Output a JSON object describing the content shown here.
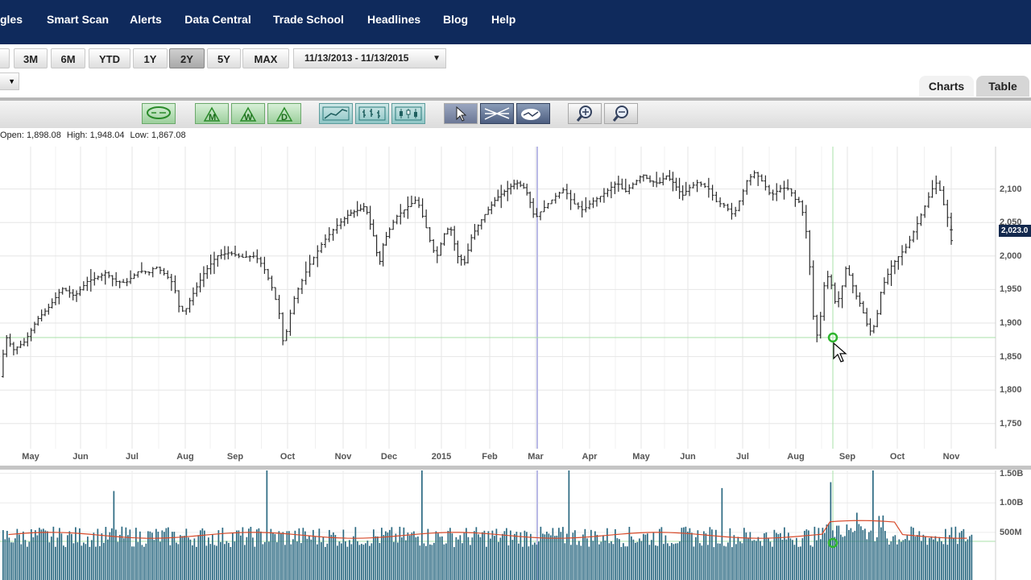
{
  "nav": {
    "items": [
      "gles",
      "Smart Scan",
      "Alerts",
      "Data Central",
      "Trade School",
      "Headlines",
      "Blog",
      "Help"
    ]
  },
  "range": {
    "buttons": [
      "3M",
      "6M",
      "YTD",
      "1Y",
      "2Y",
      "5Y",
      "MAX"
    ],
    "selected": "2Y",
    "date_range": "11/13/2013 - 11/13/2015"
  },
  "view_tabs": [
    "Charts",
    "Table"
  ],
  "toolbar": {
    "icons": [
      "comment-icon",
      "monthly-m-icon",
      "weekly-w-icon",
      "daily-d-icon",
      "line-chart-icon",
      "ohlc-bar-icon",
      "candlestick-icon",
      "pointer-icon",
      "draw-lines-icon",
      "overlay-icon",
      "zoom-in-icon",
      "zoom-out-icon"
    ]
  },
  "ohlc": {
    "open": "Open: 1,898.08",
    "high": "High: 1,948.04",
    "low": "Low: 1,867.08"
  },
  "chart_data": {
    "type": "ohlc-bar",
    "x_tick_labels": [
      "May",
      "Jun",
      "Jul",
      "Aug",
      "Sep",
      "Oct",
      "Nov",
      "Dec",
      "2015",
      "Feb",
      "Mar",
      "Apr",
      "May",
      "Jun",
      "Jul",
      "Aug",
      "Sep",
      "Oct",
      "Nov"
    ],
    "y_tick_labels": [
      "2,100",
      "2,050",
      "2,000",
      "1,950",
      "1,900",
      "1,850",
      "1,800",
      "1,750"
    ],
    "ylim": [
      1725,
      2150
    ],
    "current_price_label": "2,023.0",
    "price_series": [
      [
        0,
        1820
      ],
      [
        0.25,
        1880
      ],
      [
        0.55,
        1860
      ],
      [
        1,
        1872
      ],
      [
        1.5,
        1905
      ],
      [
        2,
        1925
      ],
      [
        2.5,
        1952
      ],
      [
        3,
        1940
      ],
      [
        3.5,
        1962
      ],
      [
        4,
        1970
      ],
      [
        4.2,
        1975
      ],
      [
        4.6,
        1962
      ],
      [
        5,
        1960
      ],
      [
        5.5,
        1978
      ],
      [
        5.9,
        1975
      ],
      [
        6.1,
        1985
      ],
      [
        6.5,
        1972
      ],
      [
        6.8,
        1958
      ],
      [
        7,
        1925
      ],
      [
        7.2,
        1915
      ],
      [
        7.5,
        1940
      ],
      [
        8,
        1975
      ],
      [
        8.5,
        2000
      ],
      [
        9,
        2005
      ],
      [
        9.5,
        1998
      ],
      [
        10,
        2000
      ],
      [
        10.3,
        1985
      ],
      [
        10.6,
        1958
      ],
      [
        10.9,
        1920
      ],
      [
        11.1,
        1862
      ],
      [
        11.25,
        1900
      ],
      [
        11.5,
        1940
      ],
      [
        12,
        1985
      ],
      [
        12.5,
        2020
      ],
      [
        13,
        2045
      ],
      [
        13.5,
        2063
      ],
      [
        14,
        2070
      ],
      [
        14.2,
        2075
      ],
      [
        14.4,
        2050
      ],
      [
        14.6,
        2025
      ],
      [
        14.8,
        1985
      ],
      [
        15,
        2020
      ],
      [
        15.5,
        2058
      ],
      [
        16,
        2075
      ],
      [
        16.3,
        2085
      ],
      [
        16.6,
        2050
      ],
      [
        16.9,
        2010
      ],
      [
        17.1,
        2000
      ],
      [
        17.3,
        2030
      ],
      [
        17.6,
        2045
      ],
      [
        17.9,
        2000
      ],
      [
        18.2,
        1990
      ],
      [
        18.5,
        2030
      ],
      [
        19,
        2060
      ],
      [
        19.5,
        2085
      ],
      [
        20,
        2100
      ],
      [
        20.4,
        2110
      ],
      [
        20.8,
        2100
      ],
      [
        21,
        2080
      ],
      [
        21.2,
        2055
      ],
      [
        21.5,
        2070
      ],
      [
        22,
        2090
      ],
      [
        22.3,
        2100
      ],
      [
        22.6,
        2080
      ],
      [
        23,
        2068
      ],
      [
        23.3,
        2080
      ],
      [
        23.7,
        2090
      ],
      [
        24,
        2100
      ],
      [
        24.3,
        2110
      ],
      [
        24.6,
        2095
      ],
      [
        25,
        2110
      ],
      [
        25.3,
        2122
      ],
      [
        25.6,
        2112
      ],
      [
        26,
        2108
      ],
      [
        26.3,
        2120
      ],
      [
        26.6,
        2110
      ],
      [
        27,
        2090
      ],
      [
        27.3,
        2102
      ],
      [
        27.6,
        2110
      ],
      [
        28,
        2100
      ],
      [
        28.3,
        2080
      ],
      [
        28.6,
        2075
      ],
      [
        28.9,
        2060
      ],
      [
        29.1,
        2080
      ],
      [
        29.4,
        2112
      ],
      [
        29.7,
        2125
      ],
      [
        30,
        2110
      ],
      [
        30.3,
        2090
      ],
      [
        30.7,
        2102
      ],
      [
        31,
        2100
      ],
      [
        31.2,
        2085
      ],
      [
        31.4,
        2080
      ],
      [
        31.6,
        2050
      ],
      [
        31.75,
        2000
      ],
      [
        31.88,
        1930
      ],
      [
        32,
        1870
      ],
      [
        32.2,
        1910
      ],
      [
        32.4,
        1975
      ],
      [
        32.6,
        1960
      ],
      [
        32.8,
        1925
      ],
      [
        33,
        1948
      ],
      [
        33.2,
        1985
      ],
      [
        33.4,
        1962
      ],
      [
        33.6,
        1940
      ],
      [
        33.8,
        1925
      ],
      [
        34,
        1900
      ],
      [
        34.2,
        1885
      ],
      [
        34.4,
        1905
      ],
      [
        34.6,
        1950
      ],
      [
        35,
        1985
      ],
      [
        35.3,
        2000
      ],
      [
        35.6,
        2015
      ],
      [
        36,
        2050
      ],
      [
        36.3,
        2078
      ],
      [
        36.5,
        2098
      ],
      [
        36.7,
        2110
      ],
      [
        36.85,
        2095
      ],
      [
        37,
        2070
      ],
      [
        37.2,
        2045
      ],
      [
        37.35,
        2023
      ]
    ],
    "volume_levels": [
      "1.50B",
      "1.00B",
      "500M"
    ],
    "volume_ylim": [
      0,
      2.0
    ]
  }
}
